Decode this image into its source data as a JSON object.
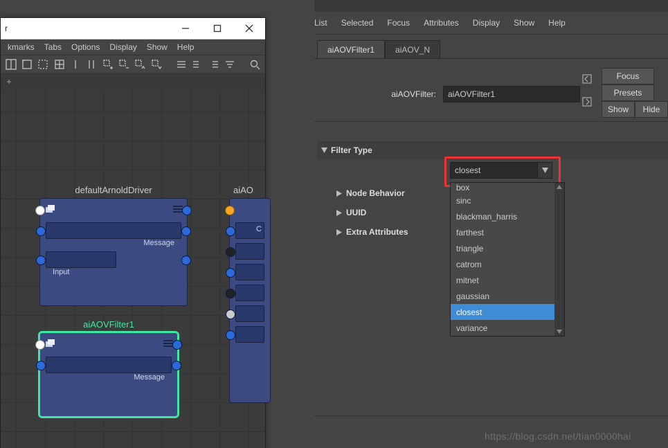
{
  "left_window": {
    "title_fragment": "r",
    "menus": [
      "kmarks",
      "Tabs",
      "Options",
      "Display",
      "Show",
      "Help"
    ],
    "tabstrip_plus": "+",
    "nodes": {
      "driver": {
        "label": "defaultArnoldDriver",
        "slot1": "Message",
        "slot2": "Input"
      },
      "filter": {
        "label": "aiAOVFilter1",
        "slot1": "Message"
      },
      "aov": {
        "label": "aiAO",
        "slot1": "C"
      }
    }
  },
  "right_panel": {
    "menus": [
      "List",
      "Selected",
      "Focus",
      "Attributes",
      "Display",
      "Show",
      "Help"
    ],
    "tabs": [
      "aiAOVFilter1",
      "aiAOV_N"
    ],
    "field_label": "aiAOVFilter:",
    "field_value": "aiAOVFilter1",
    "side_buttons": {
      "focus": "Focus",
      "presets": "Presets",
      "show": "Show",
      "hide": "Hide"
    },
    "sections": {
      "filter_type": "Filter Type",
      "node_behavior": "Node Behavior",
      "uuid": "UUID",
      "extra": "Extra Attributes"
    },
    "dropdown": {
      "value": "closest",
      "options": [
        "box",
        "sinc",
        "blackman_harris",
        "farthest",
        "triangle",
        "catrom",
        "mitnet",
        "gaussian",
        "closest",
        "variance"
      ],
      "selected": "closest"
    }
  },
  "watermark": "https://blog.csdn.net/tian0000hai"
}
